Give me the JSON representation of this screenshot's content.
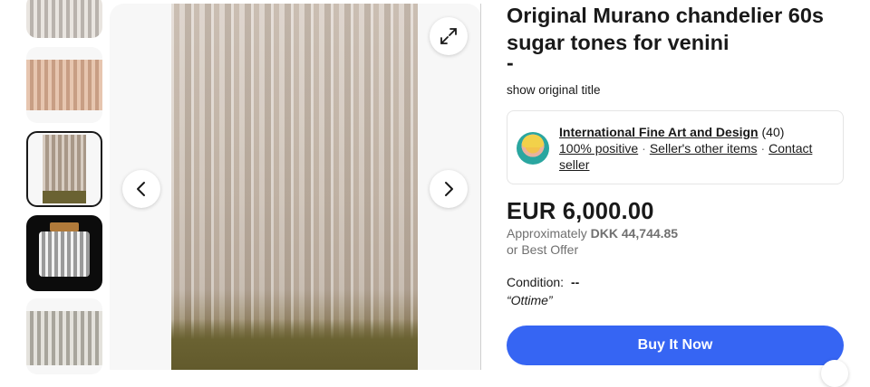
{
  "listing": {
    "title": "Original Murano chandelier 60s sugar tones for venini",
    "title_suffix": "-",
    "show_original_title": "show original title"
  },
  "seller": {
    "name": "International Fine Art and Design",
    "feedback_count": "(40)",
    "positive": "100% positive",
    "other_items": "Seller's other items",
    "contact": "Contact seller"
  },
  "price": {
    "amount": "EUR 6,000.00",
    "approx_label": "Approximately",
    "approx_value": "DKK 44,744.85",
    "best_offer": "or Best Offer"
  },
  "condition": {
    "label": "Condition:",
    "value": "--",
    "note": "“Ottime”"
  },
  "actions": {
    "buy_now": "Buy It Now"
  },
  "icons": {
    "expand": "expand-icon",
    "prev": "chevron-left-icon",
    "next": "chevron-right-icon"
  },
  "colors": {
    "buy_button": "#3665f3",
    "text": "#191919",
    "secondary_text": "#707070"
  }
}
